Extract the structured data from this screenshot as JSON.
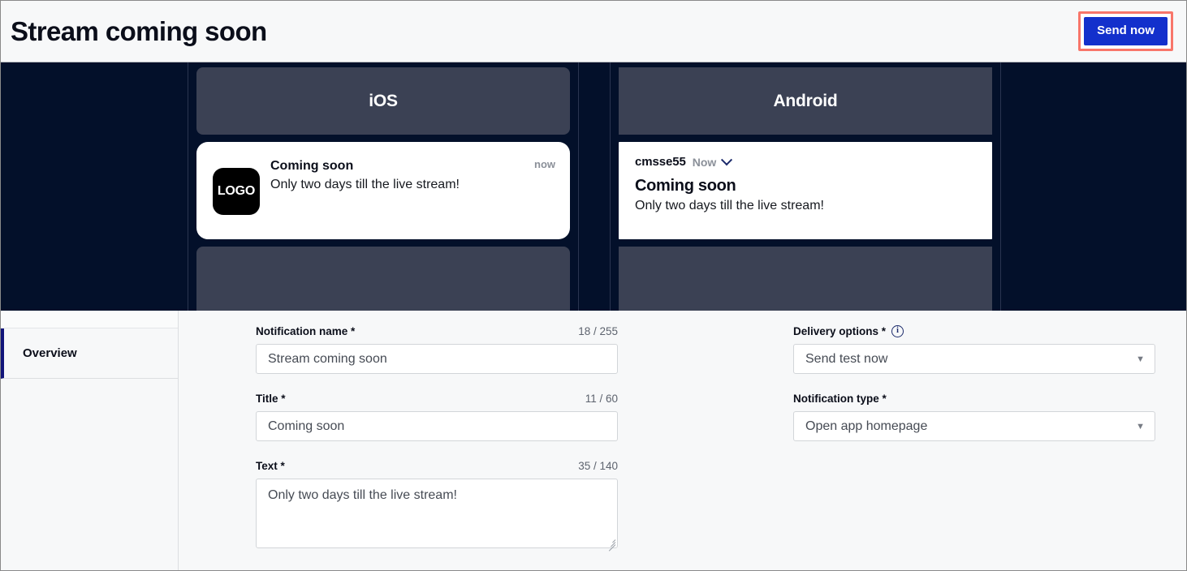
{
  "header": {
    "title": "Stream coming soon",
    "send_button": "Send now",
    "accent_blue": "#1330cc",
    "highlight_red": "#f8766a"
  },
  "preview": {
    "background": "#03102a",
    "panel_color": "#3b4154",
    "ios": {
      "os_label": "iOS",
      "logo_text": "LOGO",
      "notification_title": "Coming soon",
      "notification_text": "Only two days till the live stream!",
      "time_label": "now"
    },
    "android": {
      "os_label": "Android",
      "app_name": "cmsse55",
      "time_label": "Now",
      "expand_icon": "chevron-down-icon",
      "notification_title": "Coming soon",
      "notification_text": "Only two days till the live stream!"
    }
  },
  "sidebar": {
    "items": [
      {
        "label": "Overview",
        "active": true
      }
    ],
    "active_indicator_color": "#12157a"
  },
  "form": {
    "left": [
      {
        "label": "Notification name *",
        "counter": "18 / 255",
        "value": "Stream coming soon",
        "type": "input",
        "name": "notification-name-input"
      },
      {
        "label": "Title *",
        "counter": "11 / 60",
        "value": "Coming soon",
        "type": "input",
        "name": "title-input"
      },
      {
        "label": "Text *",
        "counter": "35 / 140",
        "value": "Only two days till the live stream!",
        "type": "textarea",
        "name": "text-textarea"
      }
    ],
    "right": [
      {
        "label": "Delivery options *",
        "has_info_icon": true,
        "value": "Send test now",
        "type": "select",
        "name": "delivery-options-select",
        "arrow": "▼"
      },
      {
        "label": "Notification type *",
        "has_info_icon": false,
        "value": "Open app homepage",
        "type": "select",
        "name": "notification-type-select",
        "arrow": "▼"
      }
    ]
  }
}
